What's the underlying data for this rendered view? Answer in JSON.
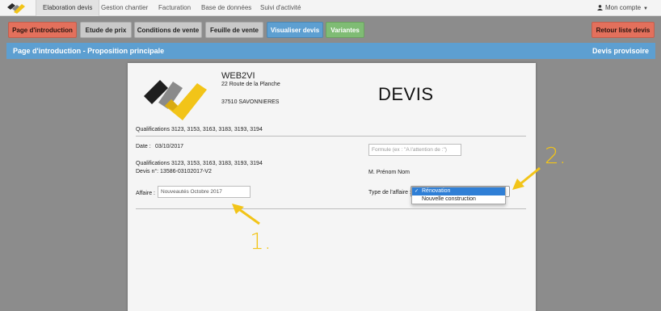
{
  "topnav": {
    "items": [
      {
        "label": "Elaboration devis",
        "active": true
      },
      {
        "label": "Gestion chantier"
      },
      {
        "label": "Facturation"
      },
      {
        "label": "Base de données"
      },
      {
        "label": "Suivi d'activité"
      }
    ],
    "account": "Mon compte"
  },
  "tabs": {
    "intro": "Page d'introduction",
    "etude": "Etude de prix",
    "conditions": "Conditions de vente",
    "feuille": "Feuille de vente",
    "visualiser": "Visualiser devis",
    "variantes": "Variantes",
    "retour": "Retour liste devis"
  },
  "banner": {
    "left": "Page d'introduction - Proposition principale",
    "right": "Devis provisoire"
  },
  "document": {
    "company": "WEB2VI",
    "address1": "22 Route de la Planche",
    "address2": "37510 SAVONNIERES",
    "title": "DEVIS",
    "qualifications_header": "Qualifications 3123, 3153, 3163, 3183, 3193, 3194",
    "date_label": "Date :",
    "date_value": "03/10/2017",
    "formule_placeholder": "Formule (ex : \"A l'attention de :\")",
    "qualifications_body": "Qualifications 3123, 3153, 3163, 3183, 3193, 3194",
    "devis_number": "Devis n°: 13586-03102017-V2",
    "client_name": "M. Prénom Nom",
    "affaire_label": "Affaire :",
    "affaire_value": "Nouveautés Octobre 2017",
    "type_label": "Type de l'affaire :",
    "type_options": [
      "Rénovation",
      "Nouvelle construction"
    ],
    "type_selected": "Rénovation"
  },
  "annotations": {
    "one": "1.",
    "two": "2."
  },
  "colors": {
    "accent_red": "#e3705c",
    "accent_blue": "#5d9fd1",
    "accent_green": "#7fbc74",
    "annotation_yellow": "#f2c418"
  },
  "icons": [
    "logo-icon",
    "user-icon",
    "caret-down-icon",
    "check-icon",
    "select-arrows-icon"
  ]
}
